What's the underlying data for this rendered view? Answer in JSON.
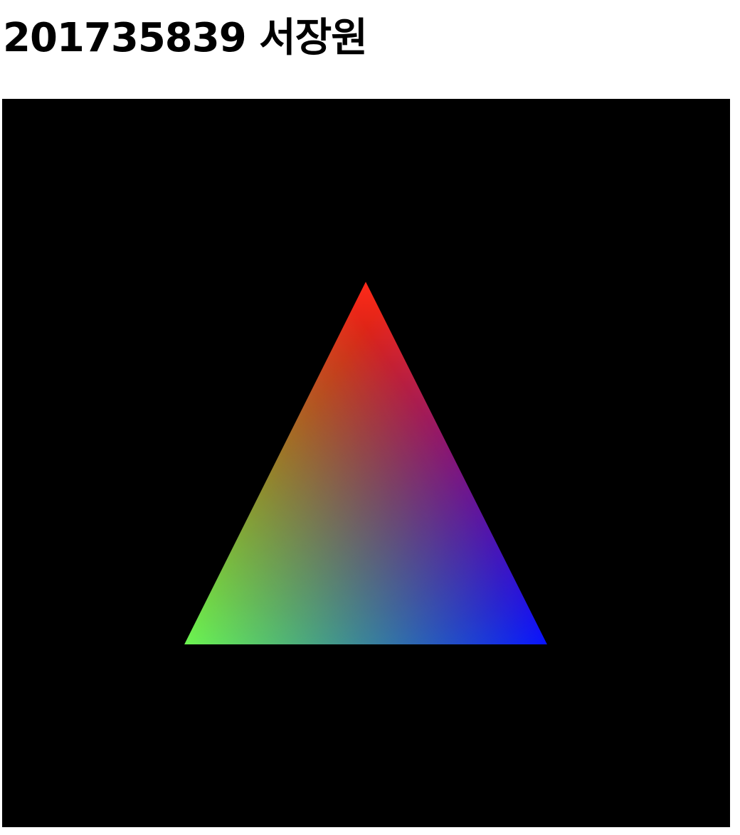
{
  "page": {
    "title": "201735839 서장원"
  },
  "canvas": {
    "background": "#000000",
    "shape": "triangle",
    "vertex_colors": {
      "top": "#ff2a1a",
      "bottom_left": "#6cf542",
      "bottom_right": "#0000ff"
    }
  }
}
